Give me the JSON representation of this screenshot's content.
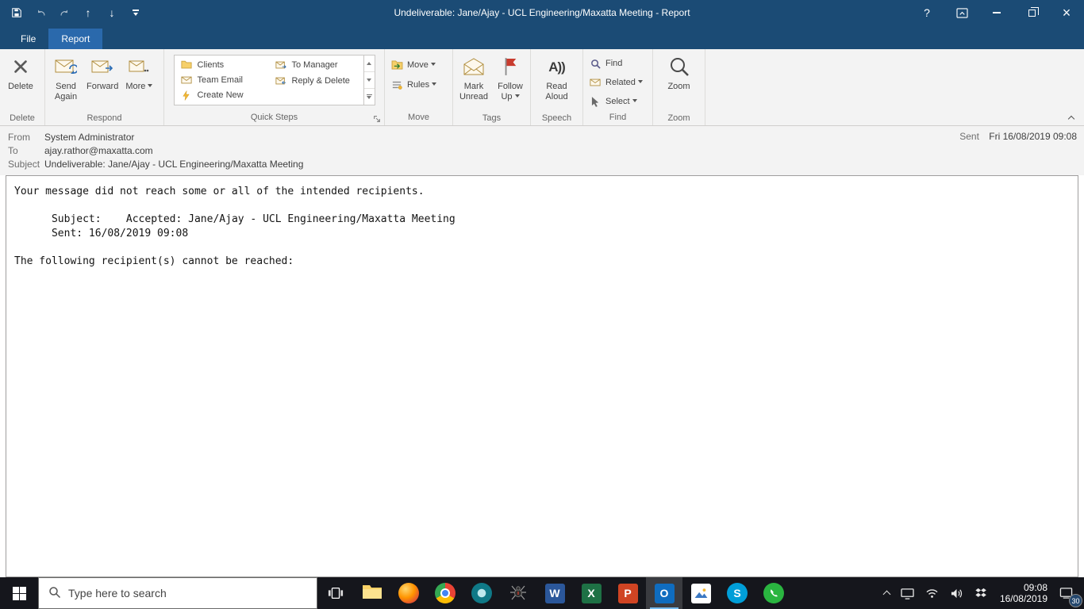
{
  "titlebar": {
    "title": "Undeliverable: Jane/Ajay - UCL Engineering/Maxatta Meeting  -  Report"
  },
  "ribbon": {
    "tabs": {
      "file": "File",
      "report": "Report"
    },
    "delete": {
      "button": "Delete",
      "label": "Delete"
    },
    "respond": {
      "send_again": "Send Again",
      "forward": "Forward",
      "more": "More",
      "label": "Respond"
    },
    "quick_steps": {
      "clients": "Clients",
      "team_email": "Team Email",
      "create_new": "Create New",
      "to_manager": "To Manager",
      "reply_delete": "Reply & Delete",
      "label": "Quick Steps"
    },
    "move": {
      "move": "Move",
      "rules": "Rules",
      "label": "Move"
    },
    "tags": {
      "mark_unread": "Mark Unread",
      "follow_up": "Follow Up",
      "label": "Tags"
    },
    "speech": {
      "read_aloud": "Read Aloud",
      "label": "Speech"
    },
    "find": {
      "find": "Find",
      "related": "Related",
      "select": "Select",
      "label": "Find"
    },
    "zoom": {
      "zoom": "Zoom",
      "label": "Zoom"
    }
  },
  "header": {
    "from_label": "From",
    "from_value": "System Administrator",
    "to_label": "To",
    "to_value": "ajay.rathor@maxatta.com",
    "subject_label": "Subject",
    "subject_value": "Undeliverable: Jane/Ajay - UCL Engineering/Maxatta Meeting",
    "sent_label": "Sent",
    "sent_value": "Fri 16/08/2019 09:08"
  },
  "body": {
    "text": "Your message did not reach some or all of the intended recipients.\n\n      Subject:    Accepted: Jane/Ajay - UCL Engineering/Maxatta Meeting\n      Sent: 16/08/2019 09:08\n\nThe following recipient(s) cannot be reached:"
  },
  "taskbar": {
    "search_placeholder": "Type here to search",
    "time": "09:08",
    "date": "16/08/2019",
    "notification_count": "30"
  },
  "icons": {
    "help": "?",
    "close": "×",
    "up_arrow": "↑",
    "down_arrow": "↓",
    "read_aloud_glyph": "A))",
    "word": "W",
    "excel": "X",
    "powerpoint": "P",
    "outlook": "O",
    "skype": "S"
  },
  "colors": {
    "titlebar_blue": "#1b4b75",
    "active_tab_blue": "#2a69ac",
    "ribbon_bg": "#f3f3f3",
    "flag_red": "#c83b2e",
    "word_blue": "#2b579a",
    "excel_green": "#1e7145",
    "powerpoint_orange": "#d04423",
    "outlook_blue": "#0f6cbf",
    "whatsapp_green": "#2ab540",
    "skype_blue": "#009ed8",
    "taskbar_dark": "#15161c"
  }
}
